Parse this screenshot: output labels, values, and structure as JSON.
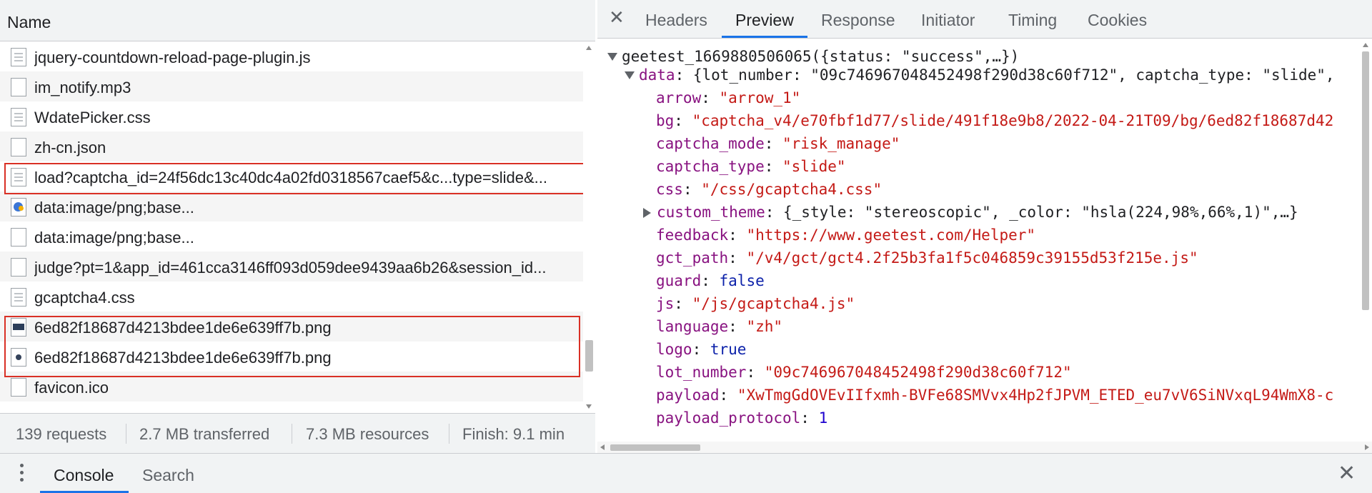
{
  "name_header": "Name",
  "requests": [
    {
      "name": "jquery-countdown-reload-page-plugin.js",
      "icon": "doc"
    },
    {
      "name": "im_notify.mp3",
      "icon": "blank"
    },
    {
      "name": "WdatePicker.css",
      "icon": "doc"
    },
    {
      "name": "zh-cn.json",
      "icon": "blank"
    },
    {
      "name": "load?captcha_id=24f56dc13c40dc4a02fd0318567caef5&c...type=slide&...",
      "icon": "doc"
    },
    {
      "name": "data:image/png;base...",
      "icon": "img-blue"
    },
    {
      "name": "data:image/png;base...",
      "icon": "blank"
    },
    {
      "name": "judge?pt=1&app_id=461cca3146ff093d059dee9439aa6b26&session_id...",
      "icon": "blank"
    },
    {
      "name": "gcaptcha4.css",
      "icon": "doc"
    },
    {
      "name": "6ed82f18687d4213bdee1de6e639ff7b.png",
      "icon": "img-dark"
    },
    {
      "name": "6ed82f18687d4213bdee1de6e639ff7b.png",
      "icon": "img-dot"
    },
    {
      "name": "favicon.ico",
      "icon": "blank"
    }
  ],
  "status": {
    "requests": "139 requests",
    "transferred": "2.7 MB transferred",
    "resources": "7.3 MB resources",
    "finish": "Finish: 9.1 min"
  },
  "tabs": {
    "close": "✕",
    "headers": "Headers",
    "preview": "Preview",
    "response": "Response",
    "initiator": "Initiator",
    "timing": "Timing",
    "cookies": "Cookies"
  },
  "preview": {
    "root": "geetest_1669880506065({status: \"success\",…})",
    "data_key": "data",
    "data_summary": "{lot_number: \"09c746967048452498f290d38c60f712\", captcha_type: \"slide\",",
    "fields": [
      {
        "key": "arrow",
        "value": "\"arrow_1\"",
        "type": "s"
      },
      {
        "key": "bg",
        "value": "\"captcha_v4/e70fbf1d77/slide/491f18e9b8/2022-04-21T09/bg/6ed82f18687d42",
        "type": "s"
      },
      {
        "key": "captcha_mode",
        "value": "\"risk_manage\"",
        "type": "s"
      },
      {
        "key": "captcha_type",
        "value": "\"slide\"",
        "type": "s"
      },
      {
        "key": "css",
        "value": "\"/css/gcaptcha4.css\"",
        "type": "s"
      },
      {
        "key": "custom_theme",
        "value": "{_style: \"stereoscopic\", _color: \"hsla(224,98%,66%,1)\",…}",
        "type": "p",
        "collapsed": true
      },
      {
        "key": "feedback",
        "value": "\"https://www.geetest.com/Helper\"",
        "type": "s"
      },
      {
        "key": "gct_path",
        "value": "\"/v4/gct/gct4.2f25b3fa1f5c046859c39155d53f215e.js\"",
        "type": "s"
      },
      {
        "key": "guard",
        "value": "false",
        "type": "b"
      },
      {
        "key": "js",
        "value": "\"/js/gcaptcha4.js\"",
        "type": "s"
      },
      {
        "key": "language",
        "value": "\"zh\"",
        "type": "s"
      },
      {
        "key": "logo",
        "value": "true",
        "type": "b"
      },
      {
        "key": "lot_number",
        "value": "\"09c746967048452498f290d38c60f712\"",
        "type": "s"
      },
      {
        "key": "payload",
        "value": "\"XwTmgGdOVEvIIfxmh-BVFe68SMVvx4Hp2fJPVM_ETED_eu7vV6SiNVxqL94WmX8-c",
        "type": "s"
      },
      {
        "key": "payload_protocol",
        "value": "1",
        "type": "n"
      }
    ]
  },
  "drawer": {
    "console": "Console",
    "search": "Search",
    "close": "✕"
  },
  "colors": {
    "accent": "#1a73e8",
    "highlight_box": "#d93025",
    "json_key": "#881280",
    "json_string": "#c41a16"
  }
}
